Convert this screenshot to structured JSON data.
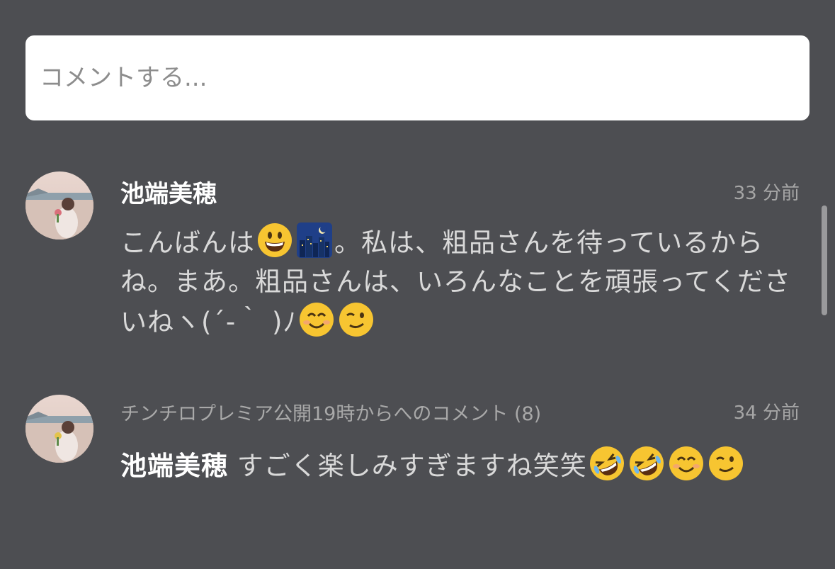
{
  "comment_input": {
    "placeholder": "コメントする..."
  },
  "comments": [
    {
      "username": "池端美穂",
      "time": "33 分前",
      "text_parts": [
        "こんばんは",
        "。私は、粗品さんを待っているからね。まあ。粗品さんは、いろんなことを頑張ってくださいねヽ(´-｀ )ﾉ"
      ],
      "emojis": [
        "grinning-face-emoji",
        "night-city-emoji",
        "smiling-face-emoji",
        "winking-face-emoji"
      ]
    },
    {
      "context": "チンチロプレミア公開19時からへのコメント (8)",
      "time": "34 分前",
      "username": "池端美穂",
      "text": "すごく楽しみすぎますね笑笑",
      "emojis": [
        "rolling-laughing-emoji",
        "rolling-laughing-emoji",
        "smiling-face-emoji",
        "winking-face-emoji"
      ]
    }
  ],
  "colors": {
    "background": "#4d4e52",
    "input_background": "#ffffff",
    "username": "#ffffff",
    "message_text": "#d9d9d9",
    "meta_text": "#a6a6a6"
  }
}
